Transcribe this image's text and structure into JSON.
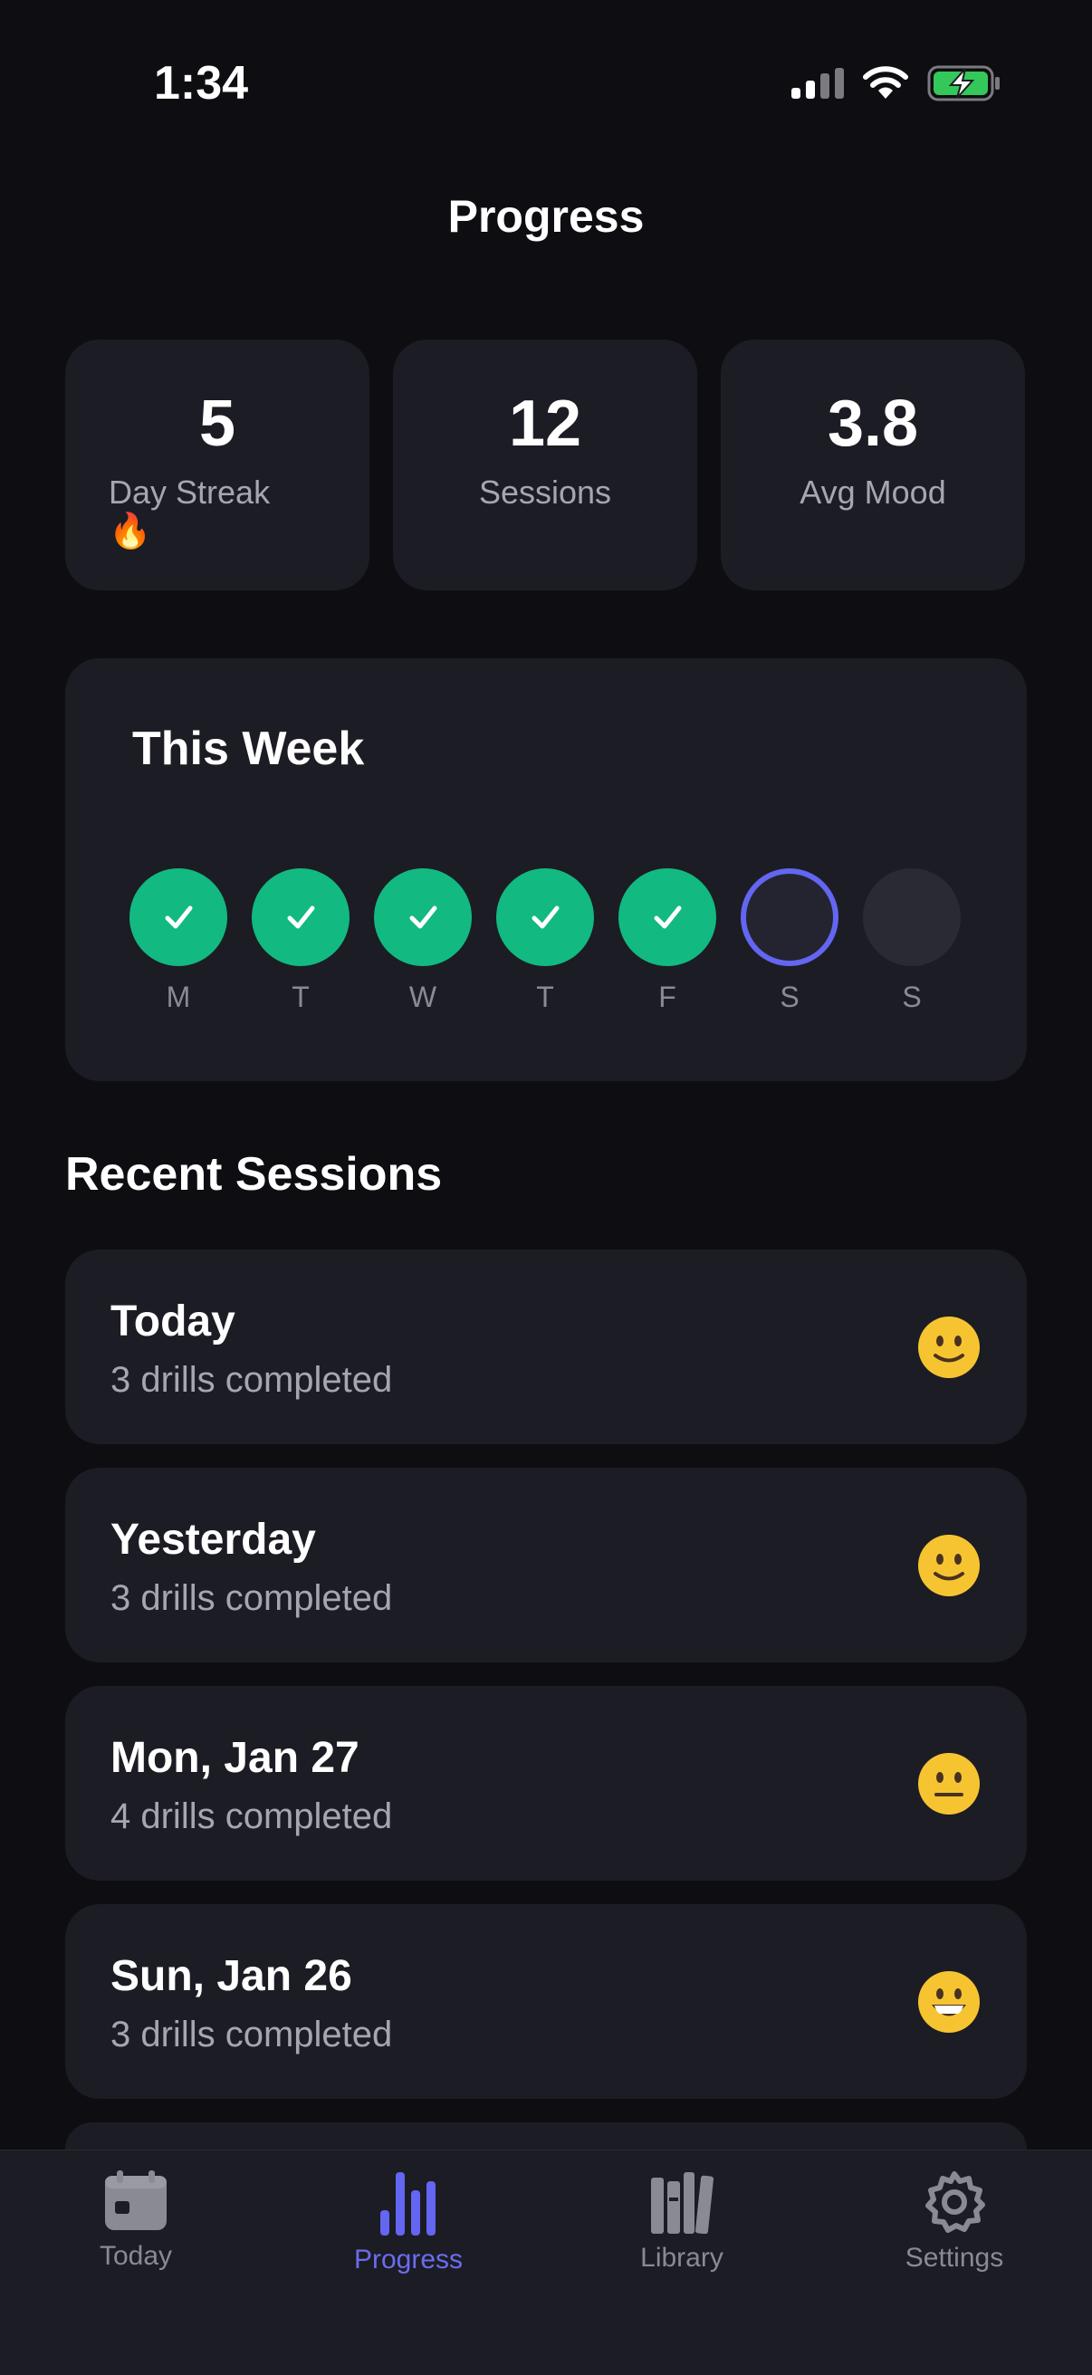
{
  "status": {
    "time": "1:34"
  },
  "header": {
    "title": "Progress"
  },
  "stats": [
    {
      "value": "5",
      "label": "Day Streak",
      "emoji": "🔥"
    },
    {
      "value": "12",
      "label": "Sessions"
    },
    {
      "value": "3.8",
      "label": "Avg Mood"
    }
  ],
  "week": {
    "title": "This Week",
    "days": [
      {
        "label": "M",
        "state": "done"
      },
      {
        "label": "T",
        "state": "done"
      },
      {
        "label": "W",
        "state": "done"
      },
      {
        "label": "T",
        "state": "done"
      },
      {
        "label": "F",
        "state": "done"
      },
      {
        "label": "S",
        "state": "today"
      },
      {
        "label": "S",
        "state": "empty"
      }
    ]
  },
  "recent": {
    "title": "Recent Sessions",
    "sessions": [
      {
        "date": "Today",
        "detail": "3 drills completed",
        "mood": "slight-smile"
      },
      {
        "date": "Yesterday",
        "detail": "3 drills completed",
        "mood": "slight-smile"
      },
      {
        "date": "Mon, Jan 27",
        "detail": "4 drills completed",
        "mood": "neutral"
      },
      {
        "date": "Sun, Jan 26",
        "detail": "3 drills completed",
        "mood": "grin"
      }
    ]
  },
  "tabs": [
    {
      "label": "Today",
      "icon": "calendar-icon"
    },
    {
      "label": "Progress",
      "icon": "bar-chart-icon",
      "active": true
    },
    {
      "label": "Library",
      "icon": "books-icon"
    },
    {
      "label": "Settings",
      "icon": "gear-icon"
    }
  ],
  "colors": {
    "accent": "#6366f1",
    "success": "#12b981",
    "card": "#1c1c24",
    "background": "#0e0e12"
  }
}
